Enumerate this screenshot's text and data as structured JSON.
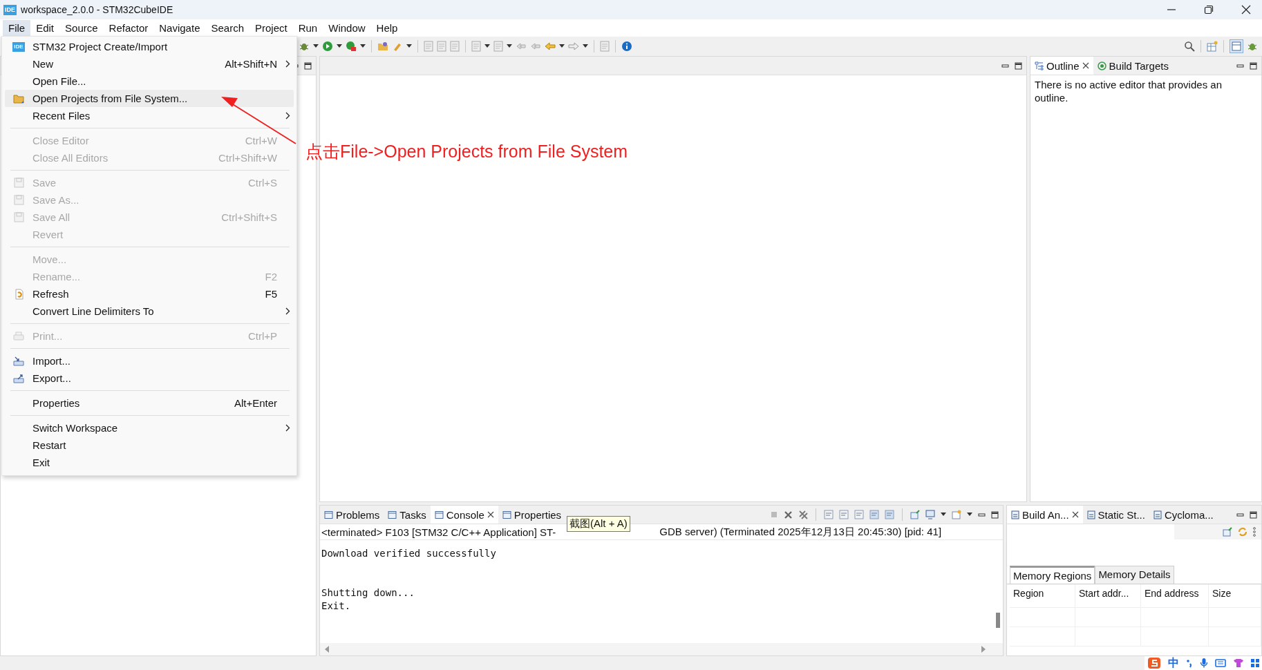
{
  "window": {
    "title": "workspace_2.0.0 - STM32CubeIDE",
    "logo_text": "IDE"
  },
  "menu_bar": [
    {
      "label": "File",
      "selected": true
    },
    {
      "label": "Edit",
      "selected": false
    },
    {
      "label": "Source",
      "selected": false
    },
    {
      "label": "Refactor",
      "selected": false
    },
    {
      "label": "Navigate",
      "selected": false
    },
    {
      "label": "Search",
      "selected": false
    },
    {
      "label": "Project",
      "selected": false
    },
    {
      "label": "Run",
      "selected": false
    },
    {
      "label": "Window",
      "selected": false
    },
    {
      "label": "Help",
      "selected": false
    }
  ],
  "file_menu": [
    {
      "kind": "item",
      "label": "STM32 Project Create/Import",
      "icon_text": "IDE",
      "disabled": false,
      "selected": false,
      "submenu": false
    },
    {
      "kind": "item",
      "label": "New",
      "shortcut": "Alt+Shift+N",
      "disabled": false,
      "selected": false,
      "submenu": true
    },
    {
      "kind": "item",
      "label": "Open File...",
      "disabled": false,
      "selected": false,
      "submenu": false
    },
    {
      "kind": "item",
      "label": "Open Projects from File System...",
      "disabled": false,
      "selected": true,
      "submenu": false
    },
    {
      "kind": "item",
      "label": "Recent Files",
      "disabled": false,
      "selected": false,
      "submenu": true
    },
    {
      "kind": "separator"
    },
    {
      "kind": "item",
      "label": "Close Editor",
      "shortcut": "Ctrl+W",
      "disabled": true,
      "selected": false,
      "submenu": false
    },
    {
      "kind": "item",
      "label": "Close All Editors",
      "shortcut": "Ctrl+Shift+W",
      "disabled": true,
      "selected": false,
      "submenu": false
    },
    {
      "kind": "separator"
    },
    {
      "kind": "item",
      "label": "Save",
      "shortcut": "Ctrl+S",
      "disabled": true,
      "selected": false,
      "submenu": false
    },
    {
      "kind": "item",
      "label": "Save As...",
      "disabled": true,
      "selected": false,
      "submenu": false
    },
    {
      "kind": "item",
      "label": "Save All",
      "shortcut": "Ctrl+Shift+S",
      "disabled": true,
      "selected": false,
      "submenu": false
    },
    {
      "kind": "item",
      "label": "Revert",
      "disabled": true,
      "selected": false,
      "submenu": false
    },
    {
      "kind": "separator"
    },
    {
      "kind": "item",
      "label": "Move...",
      "disabled": true,
      "selected": false,
      "submenu": false
    },
    {
      "kind": "item",
      "label": "Rename...",
      "shortcut": "F2",
      "disabled": true,
      "selected": false,
      "submenu": false
    },
    {
      "kind": "item",
      "label": "Refresh",
      "shortcut": "F5",
      "disabled": false,
      "selected": false,
      "submenu": false
    },
    {
      "kind": "item",
      "label": "Convert Line Delimiters To",
      "disabled": false,
      "selected": false,
      "submenu": true
    },
    {
      "kind": "separator"
    },
    {
      "kind": "item",
      "label": "Print...",
      "shortcut": "Ctrl+P",
      "disabled": true,
      "selected": false,
      "submenu": false
    },
    {
      "kind": "separator"
    },
    {
      "kind": "item",
      "label": "Import...",
      "disabled": false,
      "selected": false,
      "submenu": false
    },
    {
      "kind": "item",
      "label": "Export...",
      "disabled": false,
      "selected": false,
      "submenu": false
    },
    {
      "kind": "separator"
    },
    {
      "kind": "item",
      "label": "Properties",
      "shortcut": "Alt+Enter",
      "disabled": false,
      "selected": false,
      "submenu": false
    },
    {
      "kind": "separator"
    },
    {
      "kind": "item",
      "label": "Switch Workspace",
      "disabled": false,
      "selected": false,
      "submenu": true
    },
    {
      "kind": "item",
      "label": "Restart",
      "disabled": false,
      "selected": false,
      "submenu": false
    },
    {
      "kind": "item",
      "label": "Exit",
      "disabled": false,
      "selected": false,
      "submenu": false
    }
  ],
  "annotation": {
    "text": "点击File->Open Projects from File System"
  },
  "outline_panel": {
    "tabs": [
      {
        "label": "Outline",
        "selected": true,
        "closable": true
      },
      {
        "label": "Build Targets",
        "selected": false,
        "closable": false
      }
    ],
    "message": "There is no active editor that provides an outline."
  },
  "console_panel": {
    "tabs": [
      {
        "label": "Problems",
        "selected": false,
        "closable": false
      },
      {
        "label": "Tasks",
        "selected": false,
        "closable": false
      },
      {
        "label": "Console",
        "selected": true,
        "closable": true
      },
      {
        "label": "Properties",
        "selected": false,
        "closable": false
      }
    ],
    "header_start": "<terminated> F103 [STM32 C/C++ Application] ST-",
    "header_end": "GDB server) (Terminated 2025年12月13日 20:45:30) [pid: 41]",
    "blocks": [
      [
        "Download verified successfully"
      ],
      [
        "Shutting down...",
        "Exit."
      ]
    ]
  },
  "tooltip": {
    "text": "截图(Alt + A)"
  },
  "build_panel": {
    "tabs": [
      {
        "label": "Build An...",
        "selected": true,
        "closable": true
      },
      {
        "label": "Static St...",
        "selected": false,
        "closable": false
      },
      {
        "label": "Cycloma...",
        "selected": false,
        "closable": false
      }
    ],
    "sub_tabs": [
      {
        "label": "Memory Regions",
        "selected": true
      },
      {
        "label": "Memory Details",
        "selected": false
      }
    ],
    "columns": [
      "Region",
      "Start addr...",
      "End address",
      "Size"
    ]
  },
  "ime_bar": {
    "mode": "中"
  }
}
